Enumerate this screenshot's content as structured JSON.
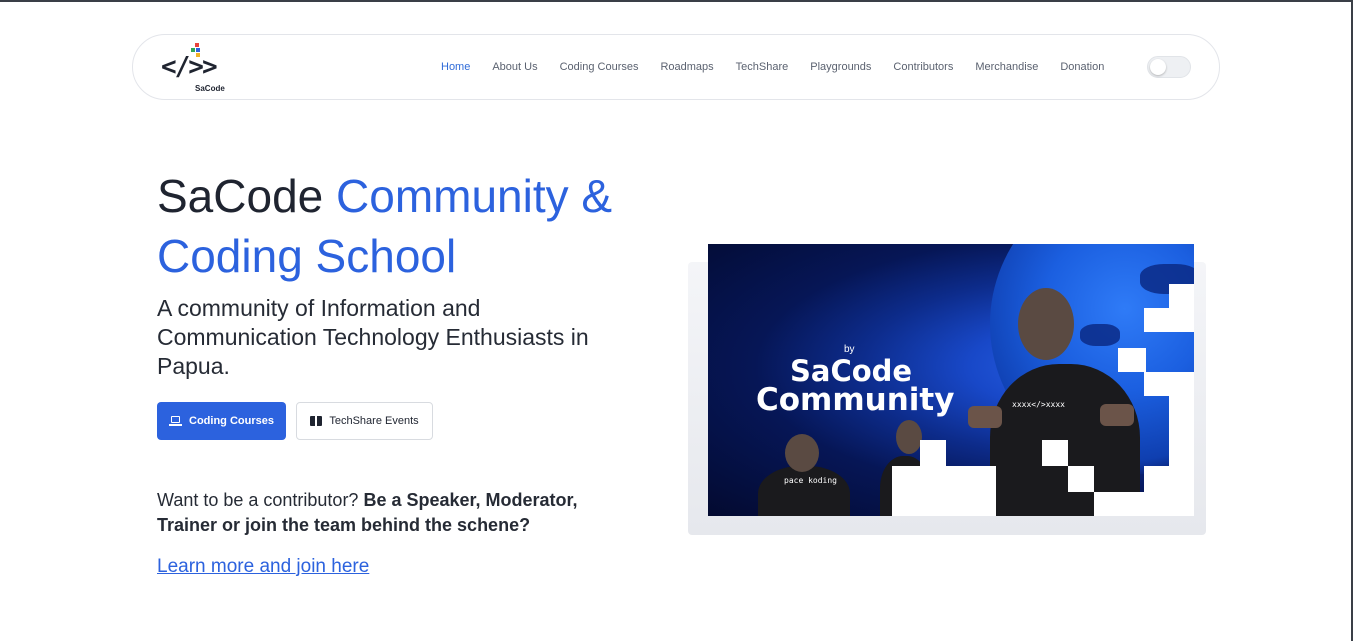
{
  "brand": {
    "logo_text": "SaCode",
    "logo_glyph": "</>>"
  },
  "nav": {
    "items": [
      {
        "label": "Home",
        "active": true
      },
      {
        "label": "About Us",
        "active": false
      },
      {
        "label": "Coding Courses",
        "active": false
      },
      {
        "label": "Roadmaps",
        "active": false
      },
      {
        "label": "TechShare",
        "active": false
      },
      {
        "label": "Playgrounds",
        "active": false
      },
      {
        "label": "Contributors",
        "active": false
      },
      {
        "label": "Merchandise",
        "active": false
      },
      {
        "label": "Donation",
        "active": false
      }
    ],
    "theme_toggle": "dark-mode-toggle"
  },
  "hero": {
    "title_plain": "SaCode ",
    "title_accent_1": "Community &",
    "title_accent_2": "Coding School",
    "subtitle": "A community of Information and Communication Technology Enthusiasts in Papua.",
    "primary_button": "Coding Courses",
    "primary_icon": "laptop-icon",
    "secondary_button": "TechShare Events",
    "secondary_icon": "book-icon",
    "contrib_plain": "Want to be a contributor? ",
    "contrib_bold": "Be a Speaker, Moderator, Trainer or join the team behind the schene?",
    "learn_link": "Learn more and join here"
  },
  "hero_image": {
    "by_text": "by",
    "brand_line_1": "SaCode",
    "brand_line_2": "Community",
    "shirt_text": "xxxx</>xxxx",
    "small_shirt_text": "pace koding"
  },
  "colors": {
    "accent": "#2c62de",
    "text": "#1f2430",
    "nav_text": "#5b6270"
  }
}
